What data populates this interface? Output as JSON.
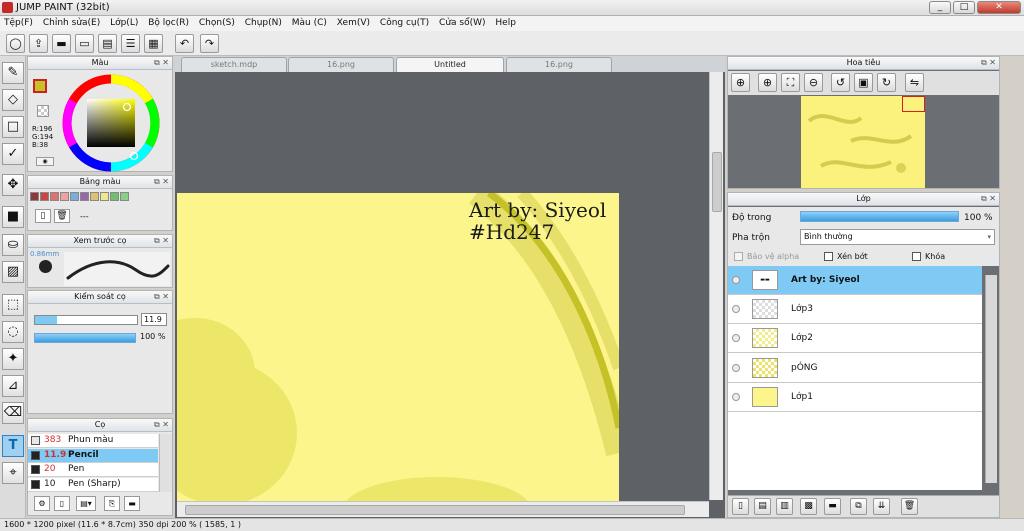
{
  "window": {
    "title": "JUMP PAINT (32bit)",
    "min": "_",
    "max": "□",
    "close": "✕"
  },
  "menu": [
    "Tệp(F)",
    "Chỉnh sửa(E)",
    "Lớp(L)",
    "Bộ lọc(R)",
    "Chọn(S)",
    "Chụp(N)",
    "Màu (C)",
    "Xem(V)",
    "Công cụ(T)",
    "Cửa sổ(W)",
    "Help"
  ],
  "color_panel": {
    "title": "Màu",
    "r": "R:196",
    "g": "G:194",
    "b": "B:38",
    "accent": "#c4c226"
  },
  "swatch_panel": {
    "title": "Bảng màu",
    "swatches": [
      "#8b3a3a",
      "#cc4444",
      "#e07070",
      "#f0a0a0",
      "#7ab0d8",
      "#9966aa",
      "#e0c070",
      "#f0e68c",
      "#70c070",
      "#88d088"
    ],
    "dash": "---"
  },
  "brush_preview": {
    "title": "Xem trước cọ",
    "size": "0.86mm"
  },
  "brush_control": {
    "title": "Kiểm soát cọ",
    "size": "11.9",
    "opacity": "100 %"
  },
  "brush_list": {
    "title": "Cọ",
    "items": [
      {
        "size": "383",
        "name": "Phun màu"
      },
      {
        "size": "11.9",
        "name": "Pencil",
        "selected": true
      },
      {
        "size": "20",
        "name": "Pen"
      },
      {
        "size": "10",
        "name": "Pen (Sharp)"
      }
    ]
  },
  "tabs": [
    {
      "label": "sketch.mdp",
      "active": false
    },
    {
      "label": "16.png",
      "active": false
    },
    {
      "label": "Untitled",
      "active": true
    },
    {
      "label": "16.png",
      "active": false
    }
  ],
  "canvas": {
    "text1": "Art by: Siyeol",
    "text2": "#Hd247",
    "bg": "#fbf58c"
  },
  "navigator": {
    "title": "Hoa tiêu"
  },
  "layer_panel": {
    "title": "Lớp",
    "opacity_label": "Độ trong",
    "opacity_value": "100 %",
    "blend_label": "Pha trộn",
    "blend_value": "Bình thường",
    "protect_alpha": "Bảo vệ alpha",
    "clip": "Xén bớt",
    "lock": "Khóa",
    "layers": [
      {
        "name": "Art by: Siyeol",
        "selected": true
      },
      {
        "name": "Lớp3",
        "selected": false
      },
      {
        "name": "Lớp2",
        "selected": false
      },
      {
        "name": "pÓNG",
        "selected": false
      },
      {
        "name": "Lớp1",
        "selected": false
      }
    ]
  },
  "status": {
    "text": "1600 * 1200 pixel  (11.6 * 8.7cm)  350 dpi  200 %  ( 1585, 1 )"
  }
}
